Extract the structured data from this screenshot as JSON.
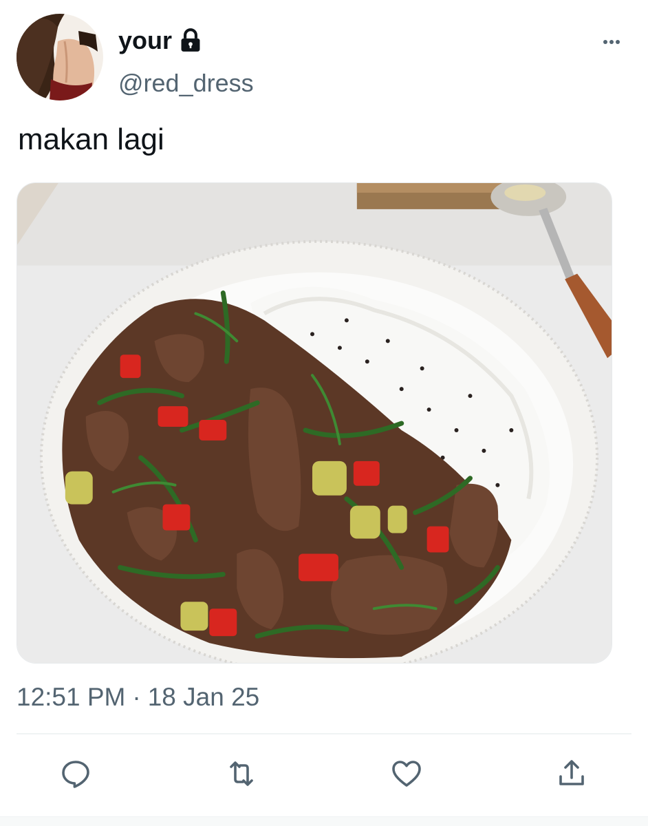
{
  "author": {
    "display_name": "your",
    "handle": "@red_dress",
    "protected_icon": "lock-icon",
    "avatar": "profile-avatar"
  },
  "menu_icon": "more-horizontal-icon",
  "tweet": {
    "text": "makan lagi",
    "media_description": "food-photo",
    "time": "12:51 PM",
    "separator": "·",
    "date": "18 Jan 25"
  },
  "actions": [
    {
      "name": "reply",
      "icon": "reply-icon"
    },
    {
      "name": "retweet",
      "icon": "retweet-icon"
    },
    {
      "name": "like",
      "icon": "heart-icon"
    },
    {
      "name": "share",
      "icon": "share-icon"
    }
  ],
  "colors": {
    "text_primary": "#0f1419",
    "text_secondary": "#536471",
    "divider": "#eff3f4"
  }
}
